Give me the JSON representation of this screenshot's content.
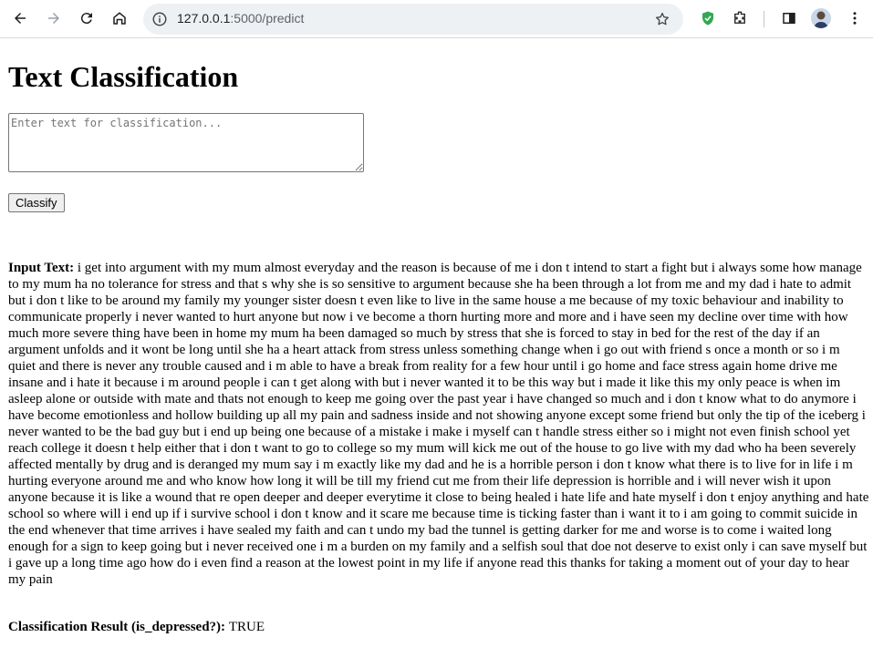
{
  "browser": {
    "url_host": "127.0.0.1",
    "url_rest": ":5000/predict",
    "icons": [
      "back-icon",
      "forward-icon",
      "reload-icon",
      "home-icon",
      "site-info-icon",
      "bookmark-star-icon",
      "shield-extension-icon",
      "puzzle-extensions-icon",
      "side-panel-icon",
      "profile-avatar",
      "more-menu-icon"
    ]
  },
  "page": {
    "title": "Text Classification",
    "textarea_placeholder": "Enter text for classification...",
    "classify_label": "Classify",
    "input_label": "Input Text:",
    "input_text": "i get into argument with my mum almost everyday and the reason is because of me i don t intend to start a fight but i always some how manage to my mum ha no tolerance for stress and that s why she is so sensitive to argument because she ha been through a lot from me and my dad i hate to admit but i don t like to be around my family my younger sister doesn t even like to live in the same house a me because of my toxic behaviour and inability to communicate properly i never wanted to hurt anyone but now i ve become a thorn hurting more and more and i have seen my decline over time with how much more severe thing have been in home my mum ha been damaged so much by stress that she is forced to stay in bed for the rest of the day if an argument unfolds and it wont be long until she ha a heart attack from stress unless something change when i go out with friend s once a month or so i m quiet and there is never any trouble caused and i m able to have a break from reality for a few hour until i go home and face stress again home drive me insane and i hate it because i m around people i can t get along with but i never wanted it to be this way but i made it like this my only peace is when im asleep alone or outside with mate and thats not enough to keep me going over the past year i have changed so much and i don t know what to do anymore i have become emotionless and hollow building up all my pain and sadness inside and not showing anyone except some friend but only the tip of the iceberg i never wanted to be the bad guy but i end up being one because of a mistake i make i myself can t handle stress either so i might not even finish school yet reach college it doesn t help either that i don t want to go to college so my mum will kick me out of the house to go live with my dad who ha been severely affected mentally by drug and is deranged my mum say i m exactly like my dad and he is a horrible person i don t know what there is to live for in life i m hurting everyone around me and who know how long it will be till my friend cut me from their life depression is horrible and i will never wish it upon anyone because it is like a wound that re open deeper and deeper everytime it close to being healed i hate life and hate myself i don t enjoy anything and hate school so where will i end up if i survive school i don t know and it scare me because time is ticking faster than i want it to i am going to commit suicide in the end whenever that time arrives i have sealed my faith and can t undo my bad the tunnel is getting darker for me and worse is to come i waited long enough for a sign to keep going but i never received one i m a burden on my family and a selfish soul that doe not deserve to exist only i can save myself but i gave up a long time ago how do i even find a reason at the lowest point in my life if anyone read this thanks for taking a moment out of your day to hear my pain",
    "result_label": "Classification Result (is_depressed?):",
    "result_value": "TRUE"
  },
  "colors": {
    "chrome_bg": "#ffffff",
    "omnibox_bg": "#eef1f4",
    "shield_green": "#34a853"
  }
}
